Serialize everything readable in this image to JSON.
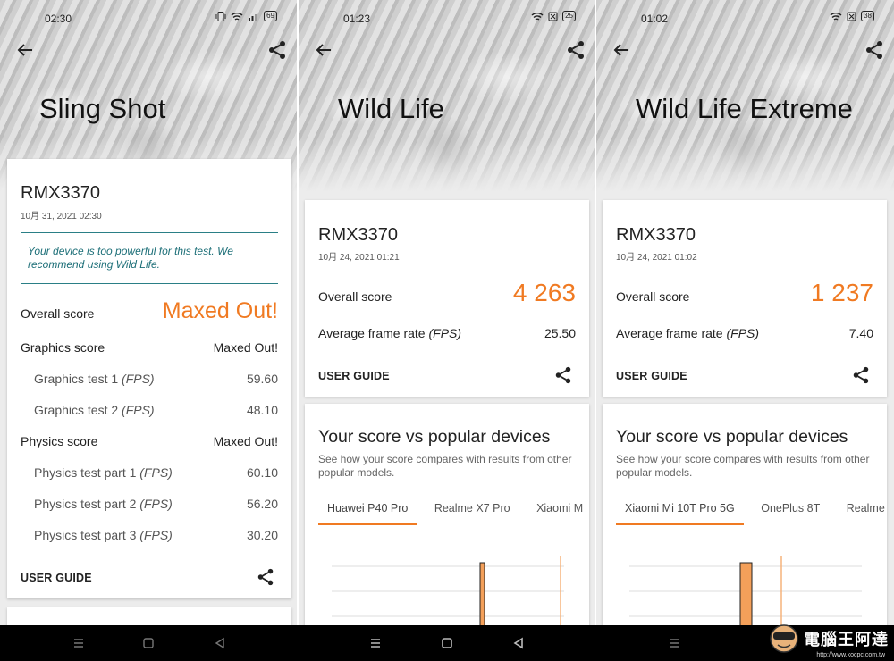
{
  "panels": [
    {
      "status_time": "02:30",
      "battery": "69",
      "title": "Sling Shot",
      "device": "RMX3370",
      "date": "10月 31, 2021 02:30",
      "notice": "Your device is too powerful for this test. We recommend using Wild Life.",
      "overall_label": "Overall score",
      "overall_value": "Maxed Out!",
      "graphics_label": "Graphics score",
      "graphics_value": "Maxed Out!",
      "graphics_tests": [
        {
          "label": "Graphics test 1",
          "unit": "(FPS)",
          "value": "59.60"
        },
        {
          "label": "Graphics test 2",
          "unit": "(FPS)",
          "value": "48.10"
        }
      ],
      "physics_label": "Physics score",
      "physics_value": "Maxed Out!",
      "physics_tests": [
        {
          "label": "Physics test part 1",
          "unit": "(FPS)",
          "value": "60.10"
        },
        {
          "label": "Physics test part 2",
          "unit": "(FPS)",
          "value": "56.20"
        },
        {
          "label": "Physics test part 3",
          "unit": "(FPS)",
          "value": "30.20"
        }
      ],
      "user_guide": "USER GUIDE"
    },
    {
      "status_time": "01:23",
      "battery": "25",
      "title": "Wild Life",
      "device": "RMX3370",
      "date": "10月 24, 2021 01:21",
      "overall_label": "Overall score",
      "overall_value": "4 263",
      "fps_label": "Average frame rate",
      "fps_unit": "(FPS)",
      "fps_value": "25.50",
      "user_guide": "USER GUIDE",
      "compare_title": "Your score vs popular devices",
      "compare_desc": "See how your score compares with results from other popular models.",
      "tabs": [
        "Huawei P40 Pro",
        "Realme X7 Pro",
        "Xiaomi M"
      ]
    },
    {
      "status_time": "01:02",
      "battery": "38",
      "title": "Wild Life Extreme",
      "device": "RMX3370",
      "date": "10月 24, 2021 01:02",
      "overall_label": "Overall score",
      "overall_value": "1 237",
      "fps_label": "Average frame rate",
      "fps_unit": "(FPS)",
      "fps_value": "7.40",
      "user_guide": "USER GUIDE",
      "compare_title": "Your score vs popular devices",
      "compare_desc": "See how your score compares with results from other popular models.",
      "tabs": [
        "Xiaomi Mi 10T Pro 5G",
        "OnePlus 8T",
        "Realme"
      ]
    }
  ],
  "watermark": {
    "text": "電腦王阿達",
    "url": "http://www.kocpc.com.tw"
  },
  "colors": {
    "accent": "#f07a22",
    "notice": "#1d6f78"
  }
}
